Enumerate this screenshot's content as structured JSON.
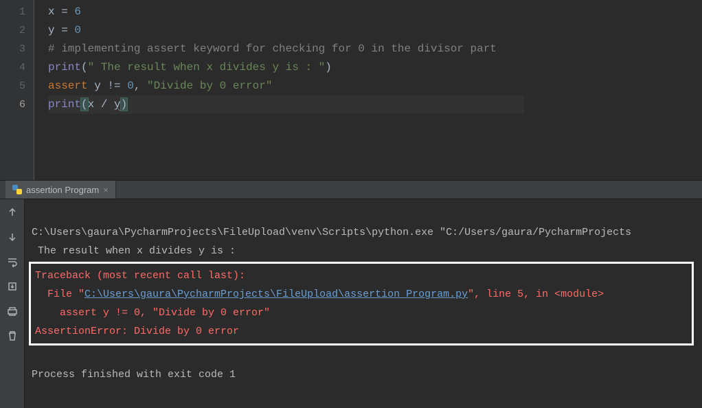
{
  "editor": {
    "lines": [
      {
        "n": "1",
        "tokens": [
          {
            "t": "x",
            "c": "tok-var"
          },
          {
            "t": " = ",
            "c": "tok-op"
          },
          {
            "t": "6",
            "c": "tok-num"
          }
        ]
      },
      {
        "n": "2",
        "tokens": [
          {
            "t": "y",
            "c": "tok-var"
          },
          {
            "t": " = ",
            "c": "tok-op"
          },
          {
            "t": "0",
            "c": "tok-num"
          }
        ]
      },
      {
        "n": "3",
        "tokens": [
          {
            "t": "# implementing assert keyword for checking for 0 in the divisor part",
            "c": "tok-cmt"
          }
        ]
      },
      {
        "n": "4",
        "tokens": [
          {
            "t": "print",
            "c": "tok-fn"
          },
          {
            "t": "(",
            "c": "tok-par"
          },
          {
            "t": "\" The result when x divides y is : \"",
            "c": "tok-str"
          },
          {
            "t": ")",
            "c": "tok-par"
          }
        ]
      },
      {
        "n": "5",
        "tokens": [
          {
            "t": "assert",
            "c": "tok-kw"
          },
          {
            "t": " y != ",
            "c": "tok-var"
          },
          {
            "t": "0",
            "c": "tok-num"
          },
          {
            "t": ", ",
            "c": "tok-op"
          },
          {
            "t": "\"Divide by 0 error\"",
            "c": "tok-str"
          }
        ]
      },
      {
        "n": "6",
        "current": true,
        "tokens": [
          {
            "t": "print",
            "c": "tok-fn"
          },
          {
            "t": "(",
            "c": "tok-par hl-paren"
          },
          {
            "t": "x / ",
            "c": "tok-var"
          },
          {
            "t": "y",
            "c": "tok-var wavy"
          },
          {
            "t": ")",
            "c": "tok-par hl-paren"
          }
        ]
      }
    ]
  },
  "run_tab": {
    "label": "assertion Program"
  },
  "console": {
    "cmd": "C:\\Users\\gaura\\PycharmProjects\\FileUpload\\venv\\Scripts\\python.exe \"C:/Users/gaura/PycharmProjects",
    "output_line": " The result when x divides y is : ",
    "traceback_header": "Traceback (most recent call last):",
    "tb_file_prefix": "  File \"",
    "tb_file_link": "C:\\Users\\gaura\\PycharmProjects\\FileUpload\\assertion Program.py",
    "tb_file_suffix": "\", line 5, in <module>",
    "tb_code": "    assert y != 0, \"Divide by 0 error\"",
    "tb_error": "AssertionError: Divide by 0 error",
    "exit": "Process finished with exit code 1"
  }
}
